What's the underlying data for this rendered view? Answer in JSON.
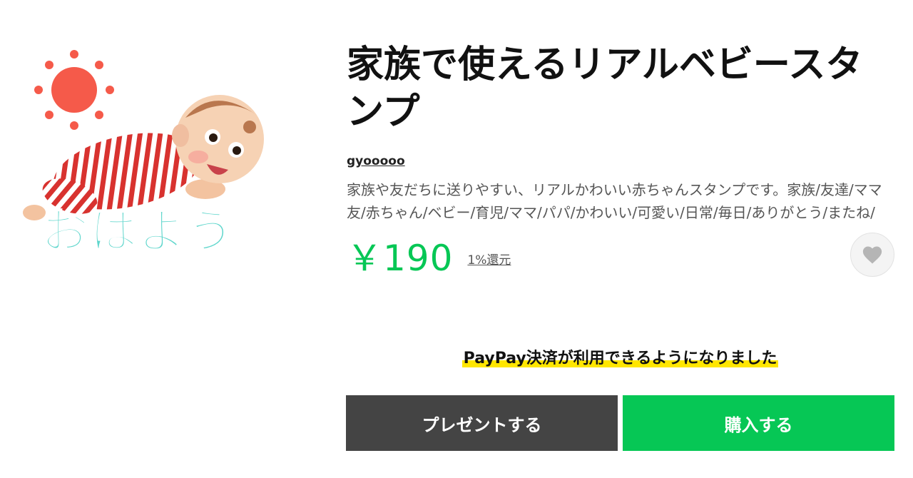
{
  "sticker": {
    "caption": "おはよう",
    "sun_color": "#f55a4a",
    "caption_color": "#5fd6cc"
  },
  "product": {
    "title": "家族で使えるリアルベビースタンプ",
    "author": "gyooooo",
    "description": "家族や友だちに送りやすい、リアルかわいい赤ちゃんスタンプです。家族/友達/ママ友/赤ちゃん/ベビー/育児/ママ/パパ/かわいい/可愛い/日常/毎日/ありがとう/またね/",
    "price": "￥190",
    "cashback": "1%還元",
    "price_color": "#06c755"
  },
  "favorite": {
    "icon": "heart-icon"
  },
  "notice": {
    "paypay": "PayPay決済が利用できるようになりました"
  },
  "actions": {
    "gift_label": "プレゼントする",
    "buy_label": "購入する"
  }
}
